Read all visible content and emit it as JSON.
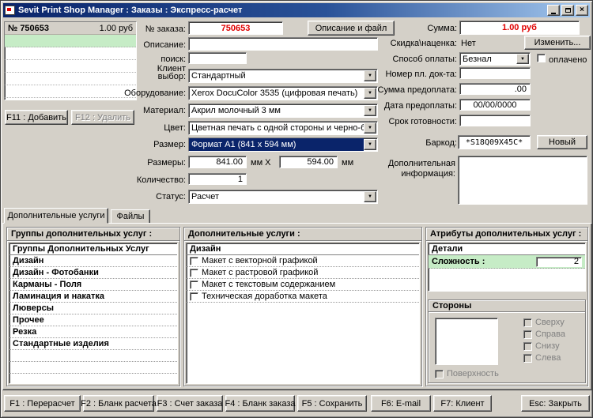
{
  "colors": {
    "accent_red": "#e00000",
    "highlight_green": "#c6ecc6",
    "selection_blue": "#0a246a",
    "window_gray": "#d4d0c8"
  },
  "window": {
    "title": "Sevit Print Shop Manager : Заказы : Экспресс-расчет"
  },
  "order_list": {
    "number": "№ 750653",
    "sum": "1.00 руб",
    "add_button": "F11 : Добавить",
    "delete_button": "F12 : Удалить"
  },
  "form": {
    "order_number_label": "№ заказа:",
    "order_number_value": "750653",
    "description_files_button": "Описание и файл",
    "description_label": "Описание:",
    "search_label": "поиск:",
    "client_section_label": "Клиент",
    "client_label": "выбор:",
    "client_value": "Стандартный",
    "equipment_label": "Оборудование:",
    "equipment_value": "Xerox DocuColor 3535 (цифровая печать)",
    "material_label": "Материал:",
    "material_value": "Акрил молочный 3 мм",
    "color_label": "Цвет:",
    "color_value": "Цветная печать с одной стороны и черно-белая с д",
    "size_label": "Размер:",
    "size_value": "Формат A1 (841 x 594 мм)",
    "dimensions_label": "Размеры:",
    "dimensions_width": "841.00",
    "dimensions_sep": "мм X",
    "dimensions_height": "594.00",
    "dimensions_unit": "мм",
    "quantity_label": "Количество:",
    "quantity_value": "1",
    "status_label": "Статус:",
    "status_value": "Расчет"
  },
  "payment": {
    "sum_label": "Сумма:",
    "sum_value": "1.00 руб",
    "change_button": "Изменить...",
    "discount_label": "Скидка\\наценка:",
    "discount_value": "Нет",
    "method_label": "Способ оплаты:",
    "method_value": "Безнал",
    "paid_checkbox": "оплачено",
    "doc_number_label": "Номер пл. док-та:",
    "prepay_sum_label": "Сумма предоплата:",
    "prepay_sum_value": ".00",
    "prepay_date_label": "Дата предоплаты:",
    "prepay_date_value": "00/00/0000",
    "ready_label": "Срок готовности:",
    "barcode_label": "Баркод:",
    "barcode_value": "*S18Q09X45C*",
    "new_button": "Новый",
    "info_label": "Дополнительная информация:"
  },
  "tabs": {
    "services": "Дополнительные услуги",
    "files": "Файлы"
  },
  "groups_panel": {
    "title": "Группы дополнительных услуг :",
    "header": "Группы Дополнительных Услуг",
    "items": [
      "Дизайн",
      "Дизайн - Фотобанки",
      "Карманы - Поля",
      "Ламинация и накатка",
      "Люверсы",
      "Прочее",
      "Резка",
      "Стандартные изделия"
    ]
  },
  "services_panel": {
    "title": "Дополнительные услуги :",
    "header": "Дизайн",
    "items": [
      "Макет с векторной графикой",
      "Макет с растровой графикой",
      "Макет с текстовым содержанием",
      "Техническая доработка макета"
    ]
  },
  "attributes_panel": {
    "title": "Атрибуты дополнительных услуг :",
    "details_header": "Детали",
    "complexity_label": "Сложность :",
    "complexity_value": "2",
    "sides_title": "Стороны",
    "sides": [
      "Сверху",
      "Справа",
      "Снизу",
      "Слева"
    ],
    "surface_checkbox": "Поверхность"
  },
  "bottom_buttons": [
    "F1 : Перерасчет",
    "F2 : Бланк расчета",
    "F3 : Счет заказа",
    "F4 : Бланк заказа",
    "F5 : Сохранить",
    "F6: E-mail",
    "F7: Клиент",
    "Esc: Закрыть"
  ]
}
